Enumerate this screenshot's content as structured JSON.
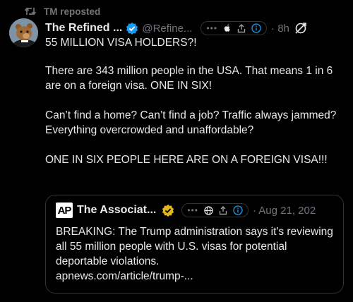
{
  "repost": {
    "label": "TM reposted"
  },
  "tweet": {
    "display_name": "The Refined ...",
    "handle": "@Refine...",
    "time": "8h",
    "pill_dots": "•••",
    "paragraphs": [
      "55 MILLION VISA HOLDERS?!",
      "There are 343 million people in the USA. That means 1 in 6 are on a foreign visa. ONE IN SIX!",
      "Can’t find a home? Can’t find a job? Traffic always jammed? Everything overcrowded and unaffordable?",
      "ONE IN SIX PEOPLE HERE ARE ON A FOREIGN VISA!!!"
    ]
  },
  "quote": {
    "logo_text": "AP",
    "display_name": "The Associat...",
    "time": "· Aug 21, 202",
    "text": "BREAKING: The Trump administration says it's reviewing all 55 million people with U.S. visas for potential deportable violations.",
    "link": "apnews.com/article/trump-..."
  },
  "colors": {
    "background": "#000000",
    "text": "#e7e9ea",
    "muted": "#71767b",
    "verified_blue": "#1d9bf0",
    "verified_gold": "#e2b719",
    "border": "#2f3336"
  },
  "icons": {
    "repost": "repost-icon",
    "verified": "verified-badge-icon",
    "apple": "apple-icon",
    "share": "share-icon",
    "info": "info-icon",
    "globe": "globe-icon",
    "ghost": "ghost-icon"
  }
}
